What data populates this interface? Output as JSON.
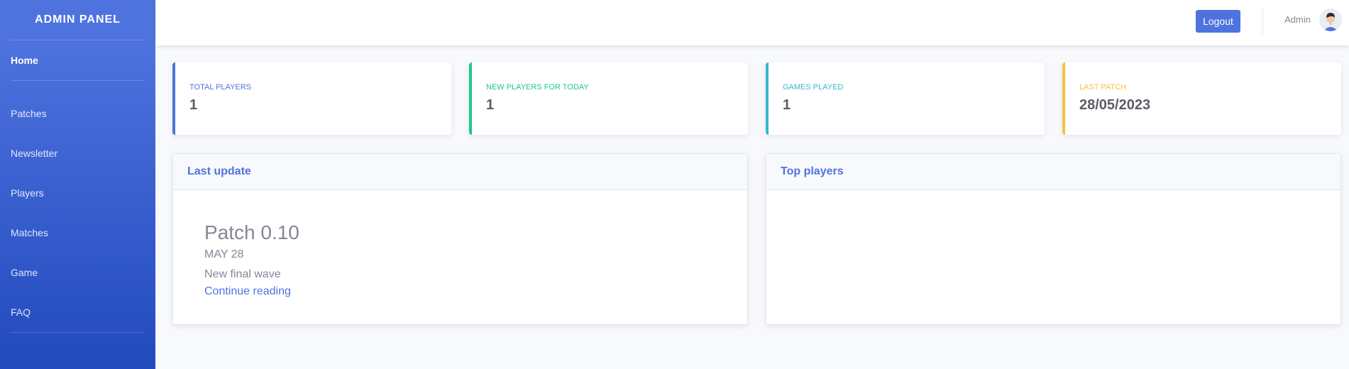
{
  "sidebar": {
    "brand": "ADMIN PANEL",
    "items": [
      {
        "label": "Home"
      },
      {
        "label": "Patches"
      },
      {
        "label": "Newsletter"
      },
      {
        "label": "Players"
      },
      {
        "label": "Matches"
      },
      {
        "label": "Game"
      },
      {
        "label": "FAQ"
      }
    ]
  },
  "topbar": {
    "logout_label": "Logout",
    "user_name": "Admin"
  },
  "stats": [
    {
      "label": "TOTAL PLAYERS",
      "value": "1",
      "color": "#4e73df"
    },
    {
      "label": "NEW PLAYERS FOR TODAY",
      "value": "1",
      "color": "#1cc88a"
    },
    {
      "label": "GAMES PLAYED",
      "value": "1",
      "color": "#36b9cc"
    },
    {
      "label": "LAST PATCH",
      "value": "28/05/2023",
      "color": "#f6c23e"
    }
  ],
  "last_update": {
    "title": "Last update",
    "patch_title": "Patch 0.10",
    "patch_date": "MAY 28",
    "patch_desc": "New final wave",
    "link_label": "Continue reading"
  },
  "top_players": {
    "title": "Top players"
  },
  "colors": {
    "primary": "#4e73df",
    "success": "#1cc88a",
    "info": "#36b9cc",
    "warning": "#f6c23e"
  }
}
